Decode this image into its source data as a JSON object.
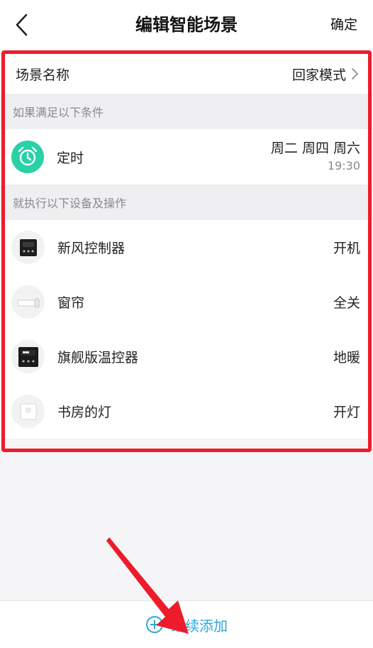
{
  "header": {
    "title": "编辑智能场景",
    "confirm_label": "确定",
    "back_icon": "chevron-left-icon"
  },
  "scene": {
    "name_label": "场景名称",
    "name_value": "回家模式"
  },
  "conditions": {
    "section_title": "如果满足以下条件",
    "timer": {
      "icon": "alarm-clock-icon",
      "label": "定时",
      "days": "周二 周四 周六",
      "time": "19:30"
    }
  },
  "actions": {
    "section_title": "就执行以下设备及操作",
    "items": [
      {
        "icon": "fresh-air-controller-icon",
        "label": "新风控制器",
        "value": "开机"
      },
      {
        "icon": "curtain-icon",
        "label": "窗帘",
        "value": "全关"
      },
      {
        "icon": "thermostat-icon",
        "label": "旗舰版温控器",
        "value": "地暖"
      },
      {
        "icon": "light-switch-icon",
        "label": "书房的灯",
        "value": "开灯"
      }
    ]
  },
  "footer": {
    "add_label": "继续添加",
    "add_icon": "plus-circle-icon"
  },
  "colors": {
    "accent": "#2aa6d8",
    "timer_icon_bg": "#2ad0a6",
    "highlight": "#ec1c2a",
    "section_bg": "#efeff1"
  }
}
